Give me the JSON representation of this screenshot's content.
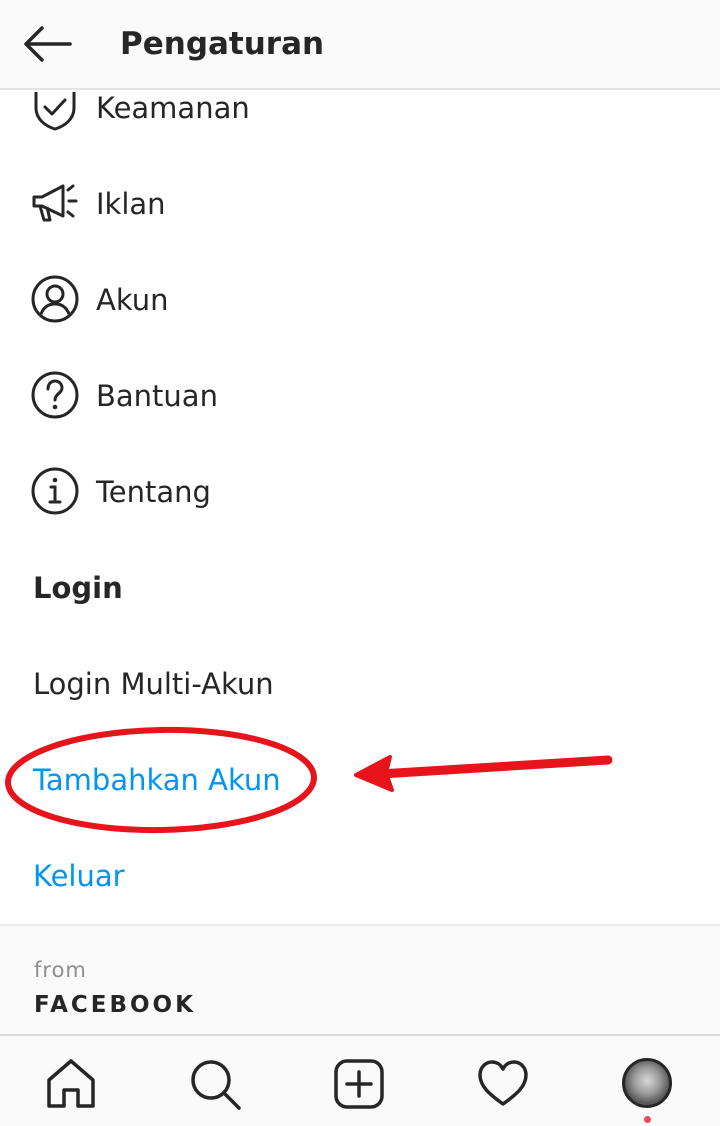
{
  "header": {
    "title": "Pengaturan",
    "back_icon": "back-arrow-icon"
  },
  "menu": [
    {
      "label": "Keamanan",
      "icon": "shield-check-icon"
    },
    {
      "label": "Iklan",
      "icon": "megaphone-icon"
    },
    {
      "label": "Akun",
      "icon": "account-circle-icon"
    },
    {
      "label": "Bantuan",
      "icon": "help-circle-icon"
    },
    {
      "label": "Tentang",
      "icon": "info-circle-icon"
    }
  ],
  "login_section": {
    "title": "Login",
    "multi_account": "Login Multi-Akun",
    "add_account": "Tambahkan Akun",
    "logout": "Keluar"
  },
  "footer": {
    "from": "from",
    "brand": "FACEBOOK"
  },
  "bottom_nav": {
    "items": [
      "home-icon",
      "search-icon",
      "new-post-icon",
      "activity-heart-icon",
      "profile-avatar"
    ]
  },
  "colors": {
    "link": "#0095f6",
    "annotation": "#e8141b",
    "text": "#262626",
    "notification": "#ed4956"
  }
}
